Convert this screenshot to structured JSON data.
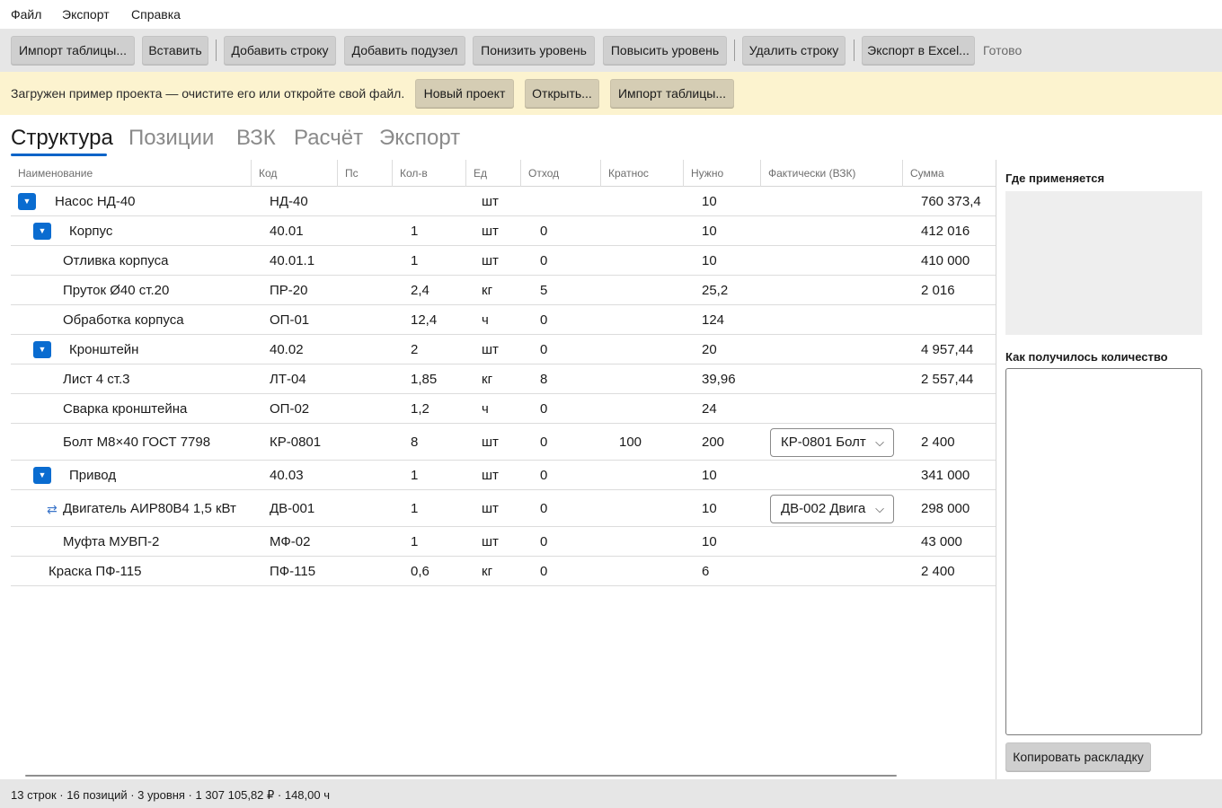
{
  "menu": {
    "file": "Файл",
    "export": "Экспорт",
    "help": "Справка"
  },
  "toolbar": {
    "import_table": "Импорт таблицы...",
    "paste": "Вставить",
    "add_row": "Добавить строку",
    "add_subnode": "Добавить подузел",
    "level_down": "Понизить уровень",
    "level_up": "Повысить уровень",
    "delete_row": "Удалить строку",
    "export_excel": "Экспорт в Excel...",
    "status": "Готово"
  },
  "banner": {
    "message": "Загружен пример проекта — очистите его или откройте свой файл.",
    "new_project": "Новый проект",
    "open": "Открыть...",
    "import_table": "Импорт таблицы..."
  },
  "tabs": {
    "structure": "Структура",
    "positions": "Позиции",
    "vzk": "ВЗК",
    "calc": "Расчёт",
    "export": "Экспорт",
    "active": "Структура"
  },
  "grid": {
    "columns": {
      "name": "Наименование",
      "code": "Код",
      "pos": "Пс",
      "qty": "Кол-в",
      "unit": "Ед",
      "waste": "Отход",
      "multiple": "Кратнос",
      "needed": "Нужно",
      "actual": "Фактически (ВЗК)",
      "sum": "Сумма"
    },
    "rows": [
      {
        "name": "Насос НД-40",
        "code": "НД-40",
        "qty": "",
        "unit": "шт",
        "waste": "",
        "multiple": "",
        "needed": "10",
        "actual": "",
        "sum": "760 373,4"
      },
      {
        "name": "Корпус",
        "code": "40.01",
        "qty": "1",
        "unit": "шт",
        "waste": "0",
        "multiple": "",
        "needed": "10",
        "actual": "",
        "sum": "412 016"
      },
      {
        "name": "Отливка корпуса",
        "code": "40.01.1",
        "qty": "1",
        "unit": "шт",
        "waste": "0",
        "multiple": "",
        "needed": "10",
        "actual": "",
        "sum": "410 000"
      },
      {
        "name": "Пруток Ø40 ст.20",
        "code": "ПР-20",
        "qty": "2,4",
        "unit": "кг",
        "waste": "5",
        "multiple": "",
        "needed": "25,2",
        "actual": "",
        "sum": "2 016"
      },
      {
        "name": "Обработка корпуса",
        "code": "ОП-01",
        "qty": "12,4",
        "unit": "ч",
        "waste": "0",
        "multiple": "",
        "needed": "124",
        "actual": "",
        "sum": ""
      },
      {
        "name": "Кронштейн",
        "code": "40.02",
        "qty": "2",
        "unit": "шт",
        "waste": "0",
        "multiple": "",
        "needed": "20",
        "actual": "",
        "sum": "4 957,44"
      },
      {
        "name": "Лист 4 ст.3",
        "code": "ЛТ-04",
        "qty": "1,85",
        "unit": "кг",
        "waste": "8",
        "multiple": "",
        "needed": "39,96",
        "actual": "",
        "sum": "2 557,44"
      },
      {
        "name": "Сварка кронштейна",
        "code": "ОП-02",
        "qty": "1,2",
        "unit": "ч",
        "waste": "0",
        "multiple": "",
        "needed": "24",
        "actual": "",
        "sum": ""
      },
      {
        "name": "Болт М8×40 ГОСТ 7798",
        "code": "КР-0801",
        "qty": "8",
        "unit": "шт",
        "waste": "0",
        "multiple": "100",
        "needed": "200",
        "actual": "КР-0801 Болт",
        "sum": "2 400"
      },
      {
        "name": "Привод",
        "code": "40.03",
        "qty": "1",
        "unit": "шт",
        "waste": "0",
        "multiple": "",
        "needed": "10",
        "actual": "",
        "sum": "341 000"
      },
      {
        "name": "Двигатель АИР80В4 1,5 кВт",
        "code": "ДВ-001",
        "qty": "1",
        "unit": "шт",
        "waste": "0",
        "multiple": "",
        "needed": "10",
        "actual": "ДВ-002 Двига",
        "sum": "298 000"
      },
      {
        "name": "Муфта МУВП-2",
        "code": "МФ-02",
        "qty": "1",
        "unit": "шт",
        "waste": "0",
        "multiple": "",
        "needed": "10",
        "actual": "",
        "sum": "43 000"
      },
      {
        "name": "Краска ПФ-115",
        "code": "ПФ-115",
        "qty": "0,6",
        "unit": "кг",
        "waste": "0",
        "multiple": "",
        "needed": "6",
        "actual": "",
        "sum": "2 400"
      }
    ]
  },
  "right_panel": {
    "where_used": "Где применяется",
    "how_qty": "Как получилось количество",
    "copy_button": "Копировать раскладку"
  },
  "status_bar": {
    "summary": "13 строк · 16 позиций · 3 уровня · 1 307 105,82 ₽ · 148,00 ч"
  },
  "icons": {
    "expander": "expand-chevron-down-icon",
    "swap": "substitution-arrows-icon",
    "combo": "chevron-down-icon"
  },
  "colors": {
    "accent": "#0a6cd0",
    "banner": "#fcf3cf",
    "toolbar": "#e6e6e6"
  }
}
